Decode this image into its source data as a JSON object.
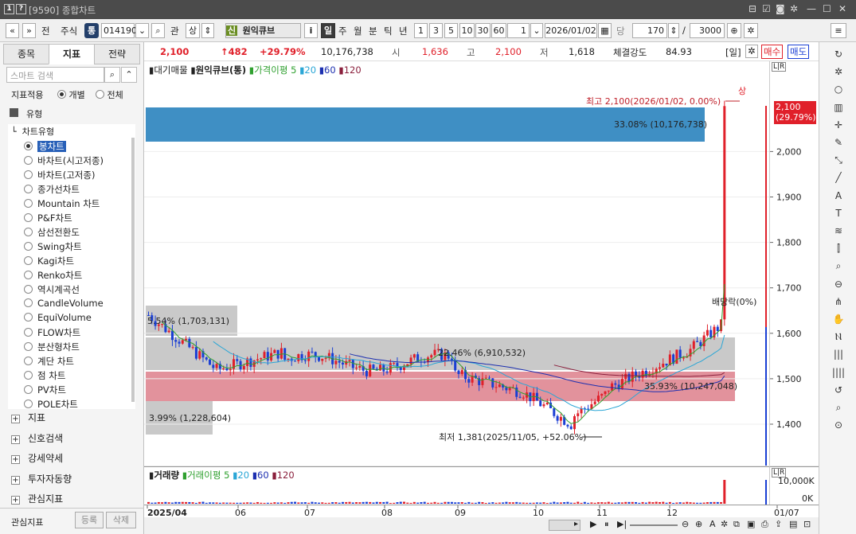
{
  "titlebar": {
    "icon1": "1",
    "icon2": "?",
    "title": "[9590] 종합차트",
    "window_icons": [
      "pin-icon",
      "save-icon",
      "camera-icon",
      "settings-icon",
      "minimize-icon",
      "maximize-icon",
      "close-icon"
    ]
  },
  "toolbar": {
    "prev": "«",
    "next": "»",
    "jeon": "전",
    "market": "주식",
    "tong": "통",
    "code": "014190",
    "gwan": "관",
    "sang": "상",
    "sin": "신",
    "name": "원익큐브",
    "info": "i",
    "periods": [
      "일",
      "주",
      "월",
      "분",
      "틱",
      "년"
    ],
    "nums": [
      "1",
      "3",
      "5",
      "10",
      "30",
      "60"
    ],
    "count_box": "1",
    "date": "2026/01/02",
    "dang": "당",
    "bars": "170",
    "slash": "/",
    "total": "3000"
  },
  "infobar": {
    "price": "2,100",
    "change": "↑482",
    "change_pct": "+29.79%",
    "volume": "10,176,738",
    "open_label": "시",
    "open": "1,636",
    "high_label": "고",
    "high": "2,100",
    "low_label": "저",
    "low": "1,618",
    "strength_label": "체결강도",
    "strength": "84.93",
    "period_tag": "[일]",
    "buy": "매수",
    "sell": "매도"
  },
  "left": {
    "tabs": [
      "종목",
      "지표",
      "전략"
    ],
    "search_placeholder": "스마트 검색",
    "apply_label": "지표적용",
    "apply_individual": "개별",
    "apply_all": "전체",
    "group": "유형",
    "subgroup": "차트유형",
    "chart_types": [
      "봉차트",
      "바차트(시고저종)",
      "바차트(고저종)",
      "종가선차트",
      "Mountain 차트",
      "P&F차트",
      "삼선전환도",
      "Swing차트",
      "Kagi차트",
      "Renko차트",
      "역시계곡선",
      "CandleVolume",
      "EquiVolume",
      "FLOW차트",
      "분산형차트",
      "계단 차트",
      "점 차트",
      "PV차트",
      "POLE차트"
    ],
    "sections": [
      "지표",
      "신호검색",
      "강세약세",
      "투자자동향",
      "관심지표"
    ],
    "footer_label": "관심지표",
    "register": "등록",
    "delete": "삭제"
  },
  "chart": {
    "legend": {
      "a": "대기매물",
      "b": "원익큐브(통)",
      "c": "가격이평",
      "c5": "5",
      "c20": "20",
      "c60": "60",
      "c120": "120"
    },
    "annotations": {
      "high": "최고 2,100(2026/01/02, 0.00%)",
      "high_tag": "상",
      "low": "최저 1,381(2025/11/05, +52.06%)",
      "dividend": "배당락(0%)",
      "vp1": "33.08% (10,176,738)",
      "vp2": "22.46% (6,910,532)",
      "vp3": "35.93% (10,247,048)",
      "vp4": "5.54% (1,703,131)",
      "vp5": "3.99% (1,228,604)"
    },
    "price_tag": "2,100",
    "price_tag_pct": "(29.79%)",
    "yticks": [
      "2,000",
      "1,900",
      "1,800",
      "1,700",
      "1,600",
      "1,500",
      "1,400"
    ],
    "volume_legend": {
      "a": "거래량",
      "b": "거래이평",
      "b5": "5",
      "b20": "20",
      "b60": "60",
      "b120": "120"
    },
    "vticks": [
      "10,000K",
      "0K"
    ],
    "xticks": [
      "2025/04",
      "06",
      "07",
      "08",
      "09",
      "10",
      "11",
      "12",
      "01/07"
    ]
  },
  "colors": {
    "up": "#e0202a",
    "down": "#1a3fd4",
    "vp_high": "#3f8fc4",
    "vp_pink": "#e2929c",
    "vp_gray": "#c9c9c9",
    "ma5": "#2fa02f",
    "ma20": "#2aa6d6",
    "ma60": "#1c2fb0",
    "ma120": "#8a1f3c"
  }
}
